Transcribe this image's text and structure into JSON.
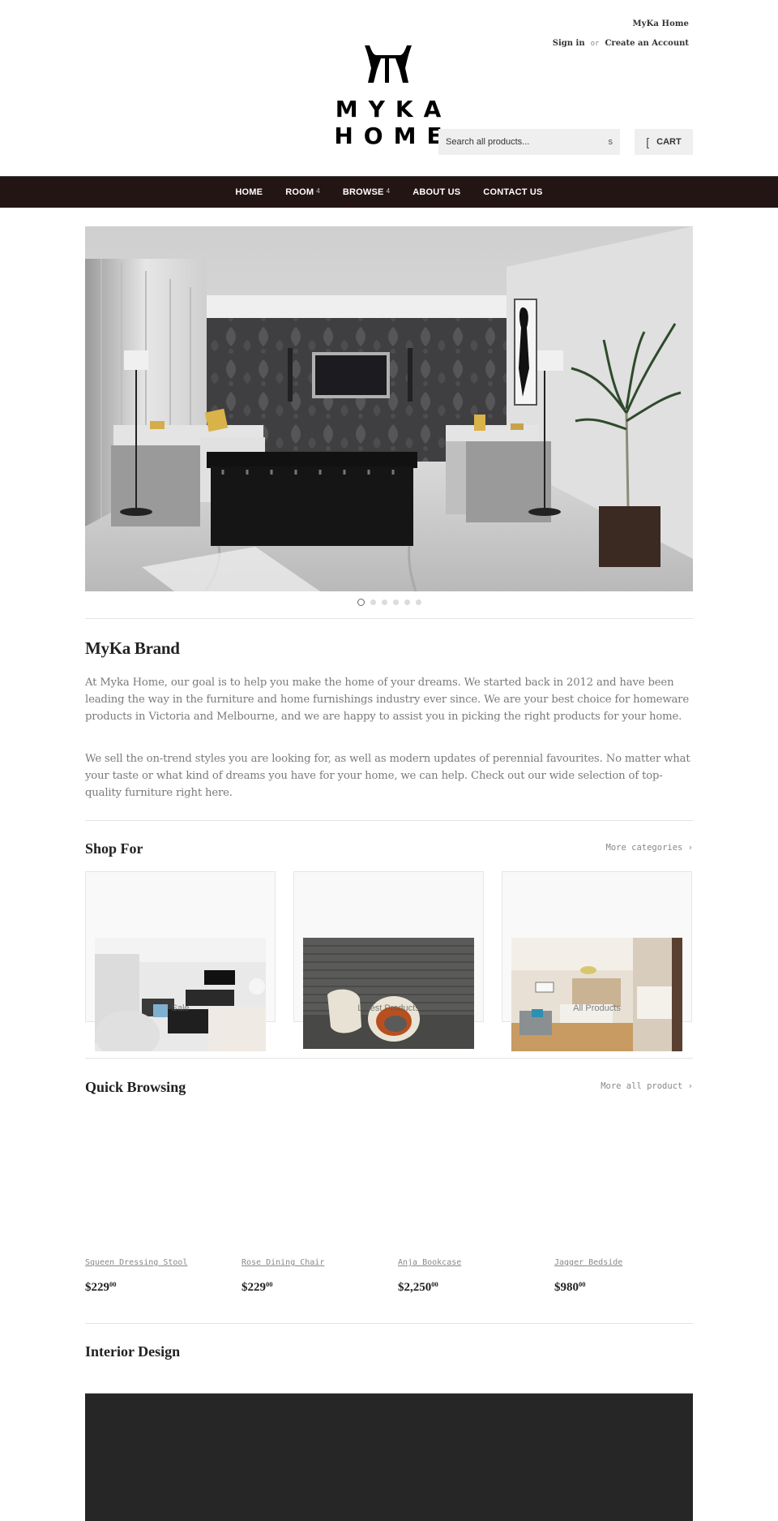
{
  "header": {
    "store_name": "MyKa Home",
    "sign_in": "Sign in",
    "or": "or",
    "create_account": "Create an Account",
    "logo_text": "MYKA HOME",
    "search_placeholder": "Search all products...",
    "search_icon_glyph": "s",
    "cart_icon_glyph": "[",
    "cart_label": "CART"
  },
  "nav": {
    "items": [
      {
        "label": "HOME",
        "has_dropdown": false
      },
      {
        "label": "ROOM",
        "has_dropdown": true,
        "caret": "4"
      },
      {
        "label": "BROWSE",
        "has_dropdown": true,
        "caret": "4"
      },
      {
        "label": "ABOUT US",
        "has_dropdown": false
      },
      {
        "label": "CONTACT US",
        "has_dropdown": false
      }
    ]
  },
  "slideshow": {
    "slide_count": 6,
    "active_index": 0
  },
  "brand": {
    "title": "MyKa Brand",
    "paragraphs": [
      "At Myka Home, our goal is to help you make the home of your dreams. We started back in 2012 and have been leading the way in the furniture and home furnishings industry ever since. We are your best choice for homeware products in Victoria and Melbourne, and we are happy to assist you in picking the right products for your home.",
      "We sell the on-trend styles you are looking for, as well as modern updates of perennial favourites. No matter what your taste or what kind of dreams you have for your home, we can help. Check out our wide selection of top-quality furniture right here."
    ]
  },
  "shop_for": {
    "title": "Shop For",
    "more_link": "More categories ›",
    "categories": [
      {
        "label": "Sale"
      },
      {
        "label": "Latest Products"
      },
      {
        "label": "All Products"
      }
    ]
  },
  "quick_browsing": {
    "title": "Quick Browsing",
    "more_link": "More all product ›",
    "products": [
      {
        "name": "Squeen Dressing Stool",
        "price_main": "$229",
        "price_cents": "00"
      },
      {
        "name": "Rose Dining Chair",
        "price_main": "$229",
        "price_cents": "00"
      },
      {
        "name": "Anja Bookcase",
        "price_main": "$2,250",
        "price_cents": "00"
      },
      {
        "name": "Jagger Bedside",
        "price_main": "$980",
        "price_cents": "00"
      }
    ]
  },
  "interior_design": {
    "title": "Interior Design"
  },
  "colors": {
    "nav_bg": "#231514",
    "interior_block": "#262626",
    "field_bg": "#efefef"
  }
}
